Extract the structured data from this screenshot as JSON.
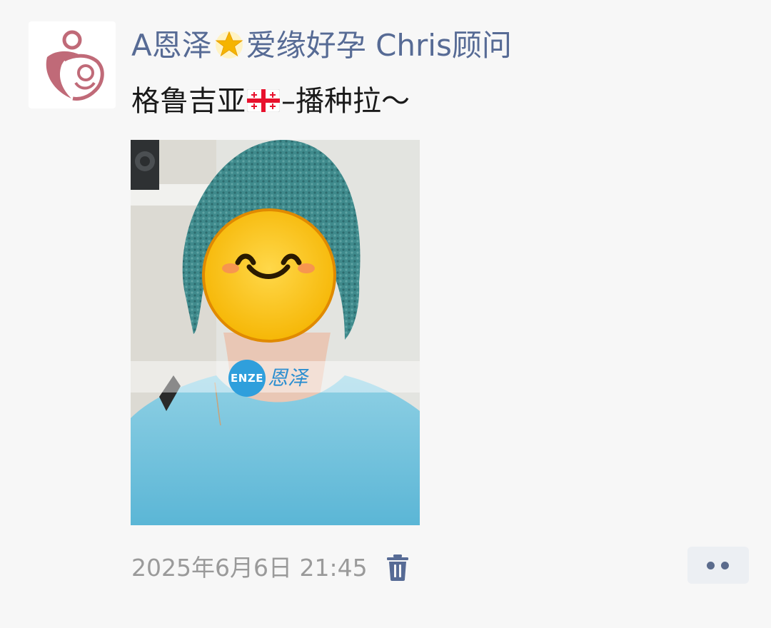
{
  "post": {
    "author_prefix": "A恩泽",
    "author_suffix": "爱缘好孕 Chris顾问",
    "author_star_icon": "glowing-star-emoji",
    "text_before_flag": "格鲁吉亚",
    "flag_icon": "georgia-flag-emoji",
    "text_after_flag": "–播种拉～",
    "photo": {
      "watermark_logo": "ENZE",
      "watermark_text": "恩泽"
    },
    "timestamp": "2025年6月6日 21:45",
    "delete_icon": "trash-icon",
    "more_icon": "more-dots-icon"
  },
  "colors": {
    "author": "#576b95",
    "body_text": "#1a1a1a",
    "meta": "#9a9a9a",
    "logo_brand": "#c06a78",
    "watermark_blue": "#2f9fdc"
  }
}
